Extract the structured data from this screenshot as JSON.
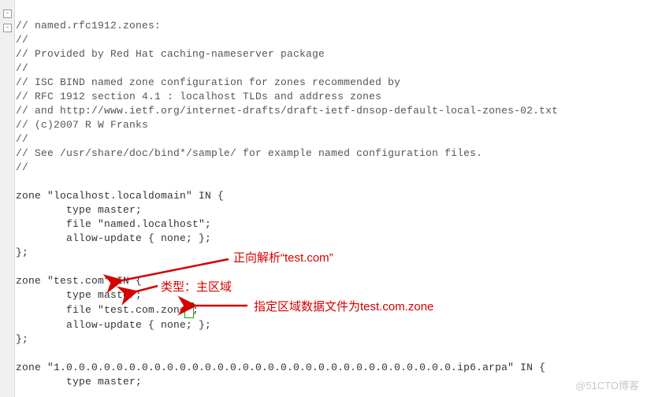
{
  "code": {
    "l01": "// named.rfc1912.zones:",
    "l02": "//",
    "l03": "// Provided by Red Hat caching-nameserver package",
    "l04": "//",
    "l05": "// ISC BIND named zone configuration for zones recommended by",
    "l06": "// RFC 1912 section 4.1 : localhost TLDs and address zones",
    "l07": "// and http://www.ietf.org/internet-drafts/draft-ietf-dnsop-default-local-zones-02.txt",
    "l08": "// (c)2007 R W Franks",
    "l09": "//",
    "l10": "// See /usr/share/doc/bind*/sample/ for example named configuration files.",
    "l11": "//",
    "l12": "",
    "l13": "zone \"localhost.localdomain\" IN {",
    "l14": "        type master;",
    "l15": "        file \"named.localhost\";",
    "l16": "        allow-update { none; };",
    "l17": "};",
    "l18": "",
    "l19": "zone \"test.com\" IN {",
    "l20": "        type master;",
    "l21a": "        file \"test.com.zone",
    "l21b": "\"",
    "l21c": ";",
    "l22": "        allow-update { none; };",
    "l23": "};",
    "l24": "",
    "l25": "zone \"1.0.0.0.0.0.0.0.0.0.0.0.0.0.0.0.0.0.0.0.0.0.0.0.0.0.0.0.0.0.0.0.ip6.arpa\" IN {",
    "l26": "        type master;"
  },
  "annotations": {
    "a1": "正向解析“test.com”",
    "a2": "类型：主区域",
    "a3": "指定区域数据文件为test.com.zone"
  },
  "watermark": "@51CTO博客",
  "arrowColor": "#d40000",
  "highlightColor": "#1a9c1a"
}
